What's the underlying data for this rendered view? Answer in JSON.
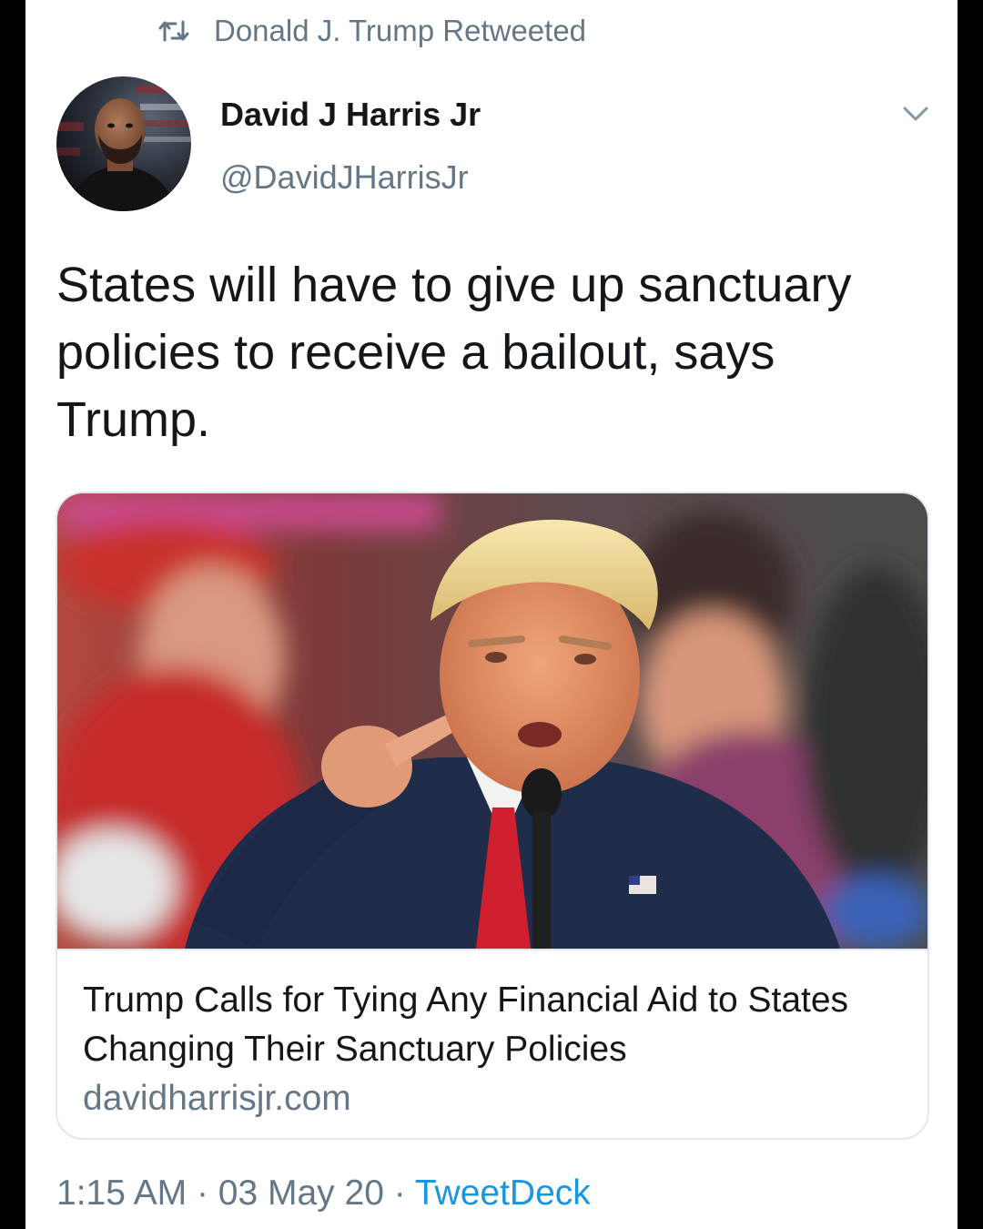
{
  "retweet": {
    "icon": "retweet-icon",
    "text": "Donald J. Trump Retweeted"
  },
  "author": {
    "name": "David J Harris Jr",
    "handle": "@DavidJHarrisJr",
    "avatar_icon": "avatar-photo"
  },
  "menu": {
    "icon": "chevron-down-icon"
  },
  "tweet": {
    "text": "States will have to give up sanctuary policies to receive a bailout, says Trump."
  },
  "card": {
    "image_icon": "link-preview-photo",
    "title": "Trump Calls for Tying Any Financial Aid to States Changing Their Sanctuary Policies",
    "domain": "davidharrisjr.com"
  },
  "meta": {
    "time": "1:15 AM",
    "separator": "·",
    "date": "03 May 20",
    "source": "TweetDeck"
  },
  "colors": {
    "text_primary": "#14171a",
    "text_secondary": "#657786",
    "link": "#1b95e0",
    "border": "#e1e8ed",
    "frame": "#000000"
  }
}
